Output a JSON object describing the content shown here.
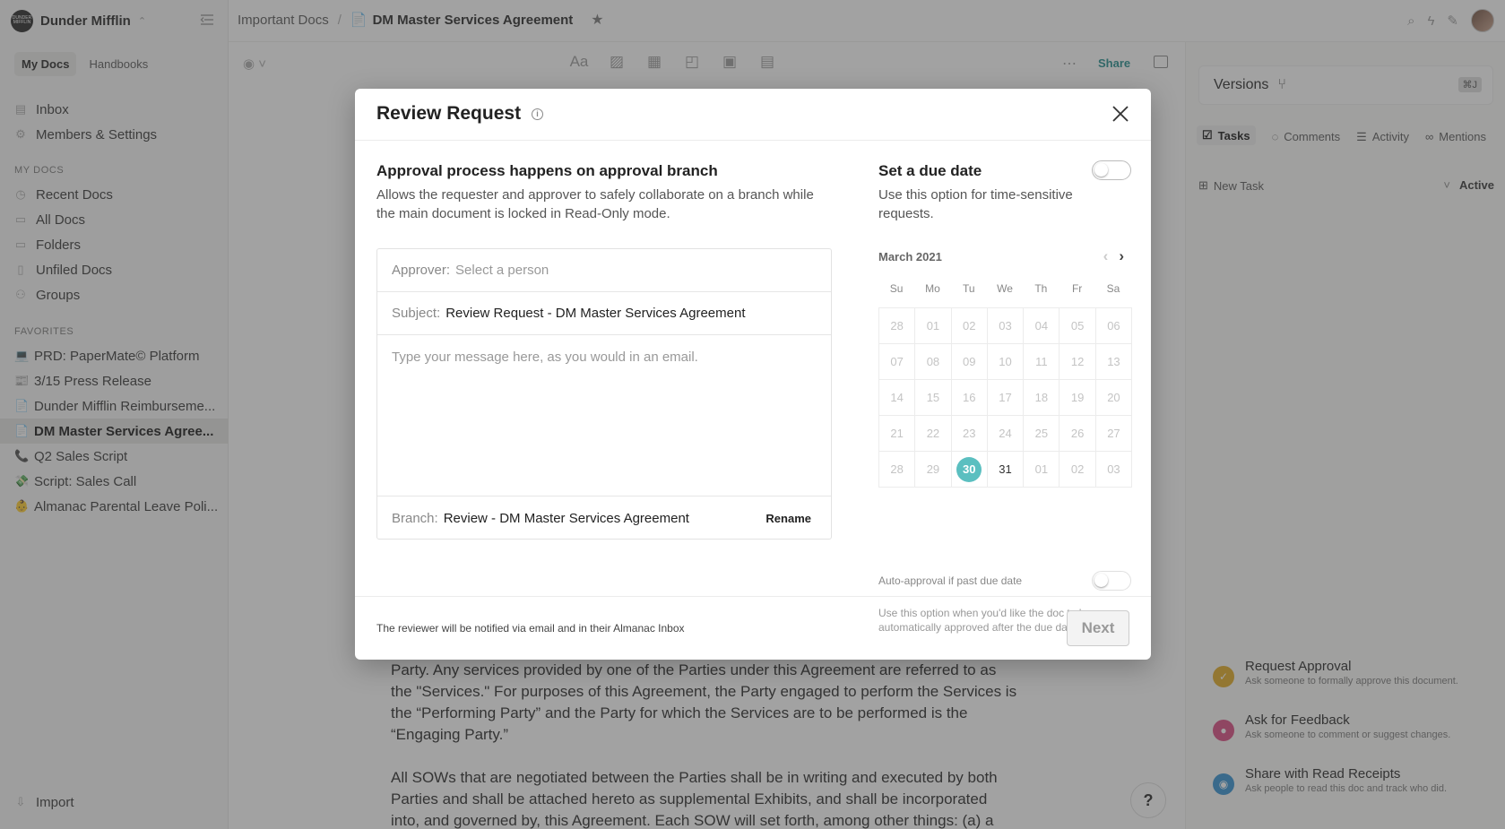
{
  "workspace": {
    "name": "Dunder Mifflin",
    "logo_text": "DUNDER MIFFLIN"
  },
  "sidebar": {
    "tabs": [
      {
        "label": "My Docs"
      },
      {
        "label": "Handbooks"
      }
    ],
    "top_items": [
      {
        "label": "Inbox",
        "icon": "inbox-icon"
      },
      {
        "label": "Members & Settings",
        "icon": "gear-icon"
      }
    ],
    "my_docs_title": "MY DOCS",
    "my_docs": [
      {
        "label": "Recent Docs",
        "icon": "clock-icon"
      },
      {
        "label": "All Docs",
        "icon": "calendar-icon"
      },
      {
        "label": "Folders",
        "icon": "folder-icon"
      },
      {
        "label": "Unfiled Docs",
        "icon": "document-icon"
      },
      {
        "label": "Groups",
        "icon": "groups-icon"
      }
    ],
    "favorites_title": "FAVORITES",
    "favorites": [
      {
        "emoji": "💻",
        "label": "PRD: PaperMate© Platform"
      },
      {
        "emoji": "📰",
        "label": "3/15 Press Release"
      },
      {
        "emoji": "📄",
        "label": "Dunder Mifflin Reimburseme..."
      },
      {
        "emoji": "📄",
        "label": "DM Master Services Agree..."
      },
      {
        "emoji": "📞",
        "label": "Q2 Sales Script"
      },
      {
        "emoji": "💸",
        "label": "Script: Sales Call"
      },
      {
        "emoji": "👶",
        "label": "Almanac Parental Leave Poli..."
      }
    ],
    "import_label": "Import"
  },
  "topbar": {
    "breadcrumb_parent": "Important Docs",
    "separator": "/",
    "doc_emoji": "📄",
    "doc_title": "DM Master Services Agreement"
  },
  "toolbar": {
    "share_label": "Share"
  },
  "document": {
    "paragraphs": [
      "Party. Any services provided by one of the Parties under this Agreement are referred to as the \"Services.\" For purposes of this Agreement, the Party engaged to perform the Services is the “Performing Party” and the Party for which the Services are to be performed is the “Engaging Party.”",
      "All SOWs that are negotiated between the Parties shall be in writing and executed by both Parties and shall be attached hereto as supplemental Exhibits, and shall be incorporated into, and governed by, this Agreement. Each SOW will set forth, among other things: (a) a"
    ]
  },
  "right_panel": {
    "versions_label": "Versions",
    "versions_shortcut": "⌘J",
    "tabs": [
      {
        "label": "Tasks"
      },
      {
        "label": "Comments"
      },
      {
        "label": "Activity"
      },
      {
        "label": "Mentions"
      }
    ],
    "new_task_label": "New Task",
    "filter_label": "Active",
    "actions": [
      {
        "title": "Request Approval",
        "subtitle": "Ask someone to formally approve this document.",
        "color": "#e0a81e"
      },
      {
        "title": "Ask for Feedback",
        "subtitle": "Ask someone to comment or suggest changes.",
        "color": "#d9477f"
      },
      {
        "title": "Share with Read Receipts",
        "subtitle": "Ask people to read this doc and track who did.",
        "color": "#2f8fd0"
      }
    ]
  },
  "help_label": "?",
  "modal": {
    "title": "Review Request",
    "left": {
      "heading": "Approval process happens on approval branch",
      "description": "Allows the requester and approver to safely collaborate on a branch while the main document is locked in Read-Only mode.",
      "approver_label": "Approver:",
      "approver_placeholder": "Select a person",
      "subject_label": "Subject:",
      "subject_value": "Review Request - DM Master Services Agreement",
      "message_placeholder": "Type your message here, as you would in an email.",
      "branch_label": "Branch:",
      "branch_value": "Review - DM Master Services Agreement",
      "rename_label": "Rename"
    },
    "right": {
      "due_heading": "Set a due date",
      "due_enabled": false,
      "due_description": "Use this option for time-sensitive requests.",
      "calendar": {
        "month": "March 2021",
        "weekdays": [
          "Su",
          "Mo",
          "Tu",
          "We",
          "Th",
          "Fr",
          "Sa"
        ],
        "days": [
          "28",
          "01",
          "02",
          "03",
          "04",
          "05",
          "06",
          "07",
          "08",
          "09",
          "10",
          "11",
          "12",
          "13",
          "14",
          "15",
          "16",
          "17",
          "18",
          "19",
          "20",
          "21",
          "22",
          "23",
          "24",
          "25",
          "26",
          "27",
          "28",
          "29",
          "30",
          "31",
          "01",
          "02",
          "03"
        ],
        "today_index": 30,
        "enabled_indices": [
          31
        ]
      },
      "auto_label": "Auto-approval if past due date",
      "auto_enabled": false,
      "auto_description": "Use this option when you'd like the doc to be automatically approved after the due date."
    },
    "footer_text": "The reviewer will be notified via email and in their Almanac Inbox",
    "next_label": "Next"
  }
}
